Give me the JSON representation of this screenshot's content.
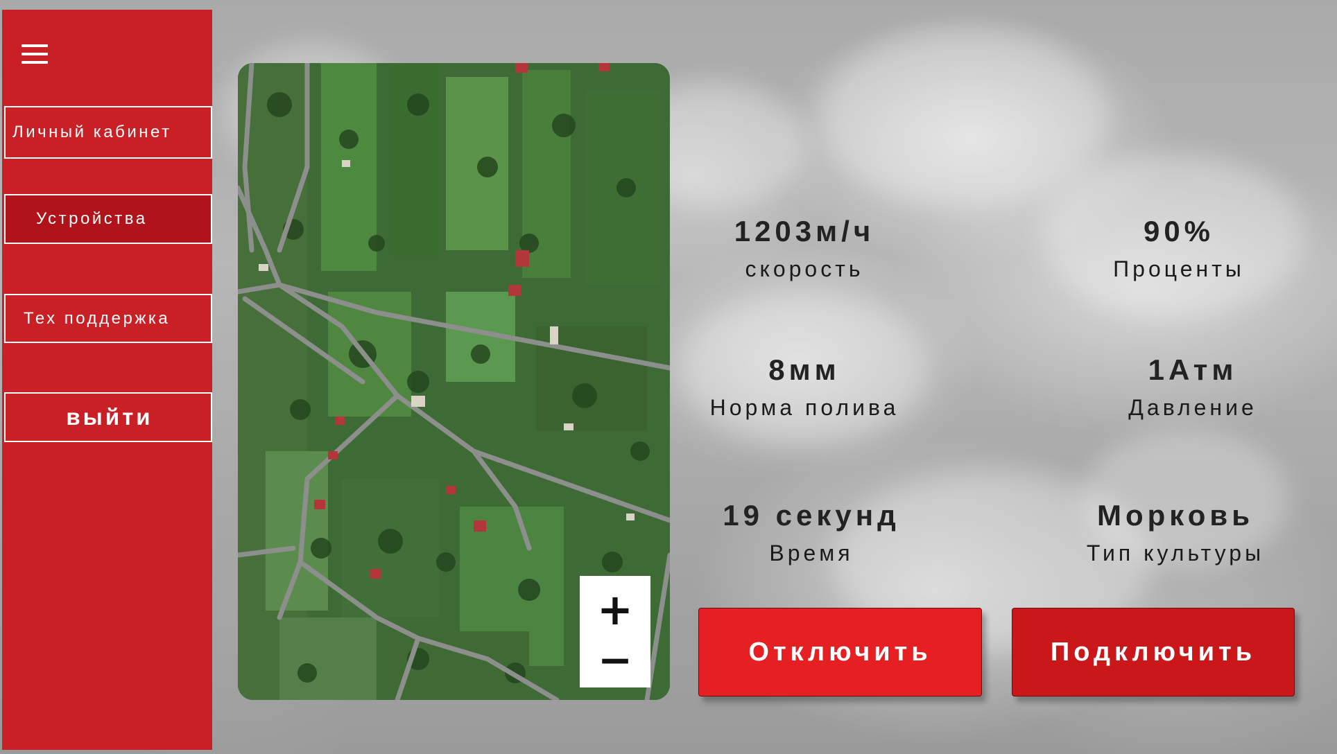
{
  "sidebar": {
    "menu_icon": "hamburger-menu-icon",
    "items": [
      {
        "label": "Личный кабинет"
      },
      {
        "label": "Устройства"
      },
      {
        "label": "Тех поддержка"
      },
      {
        "label": "выйти"
      }
    ]
  },
  "map": {
    "zoom_in": "+",
    "zoom_out": "−"
  },
  "stats": [
    {
      "value": "1203м/ч",
      "label": "скорость"
    },
    {
      "value": "90%",
      "label": "Проценты"
    },
    {
      "value": "8мм",
      "label": "Норма полива"
    },
    {
      "value": "1Атм",
      "label": "Давление"
    },
    {
      "value": "19 секунд",
      "label": "Время"
    },
    {
      "value": "Морковь",
      "label": "Тип культуры"
    }
  ],
  "actions": {
    "disconnect": "Отключить",
    "connect": "Подключить"
  },
  "colors": {
    "sidebar": "#c92026",
    "active_item": "#b0141a",
    "disconnect": "#e61f22",
    "connect": "#c9171a"
  }
}
